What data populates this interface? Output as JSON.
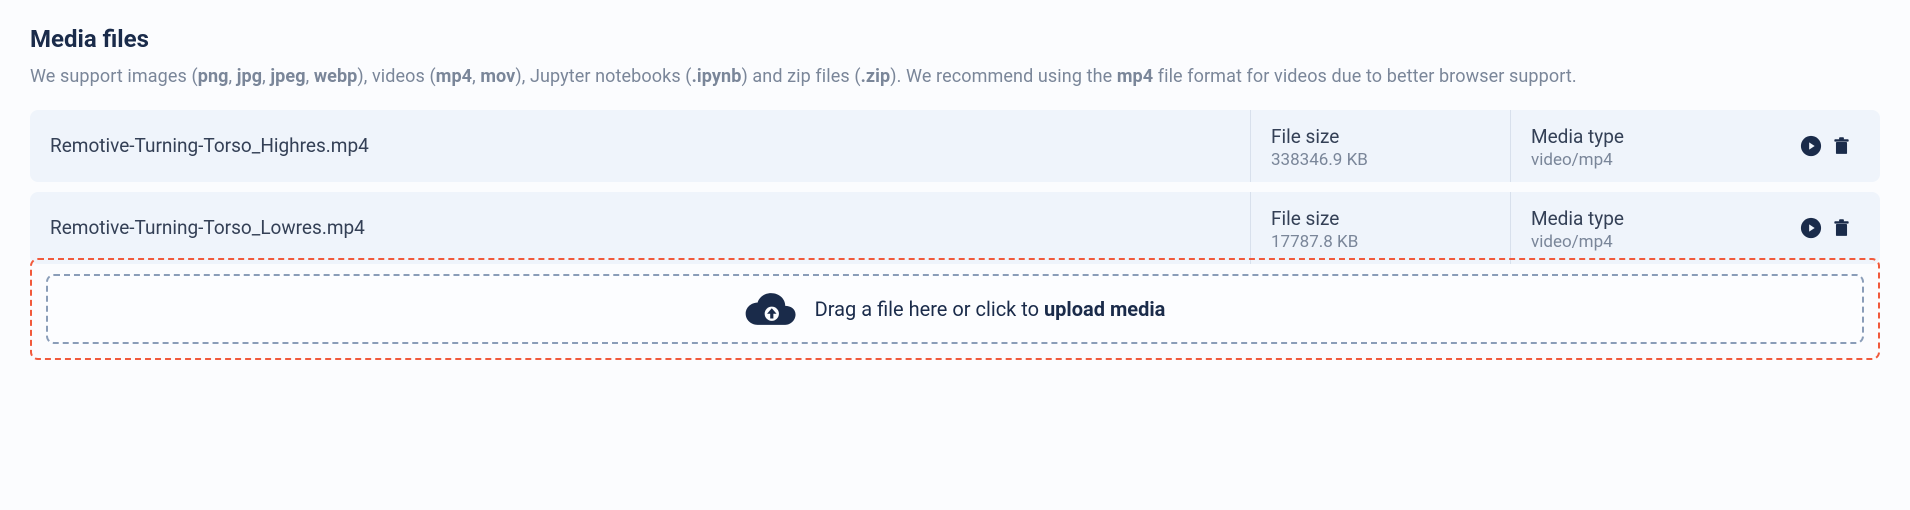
{
  "section": {
    "title": "Media files",
    "help_prefix": "We support images (",
    "img_ext": [
      "png",
      "jpg",
      "jpeg",
      "webp"
    ],
    "help_videos_intro": "), videos (",
    "vid_ext": [
      "mp4",
      "mov"
    ],
    "help_jupyter": "), Jupyter notebooks (",
    "ipynb": ".ipynb",
    "help_zip_intro": ") and zip files (",
    "zip": ".zip",
    "help_recommend_pre": "). We recommend using the ",
    "mp4": "mp4",
    "help_recommend_post": " file format for videos due to better browser support."
  },
  "labels": {
    "file_size": "File size",
    "media_type": "Media type"
  },
  "files": [
    {
      "name": "Remotive-Turning-Torso_Highres.mp4",
      "size": "338346.9 KB",
      "type": "video/mp4"
    },
    {
      "name": "Remotive-Turning-Torso_Lowres.mp4",
      "size": "17787.8 KB",
      "type": "video/mp4"
    }
  ],
  "dropzone": {
    "pre": "Drag a file here or click to ",
    "bold": "upload media"
  },
  "colors": {
    "accent": "#1a2b4a",
    "highlight": "#f15a3c"
  }
}
